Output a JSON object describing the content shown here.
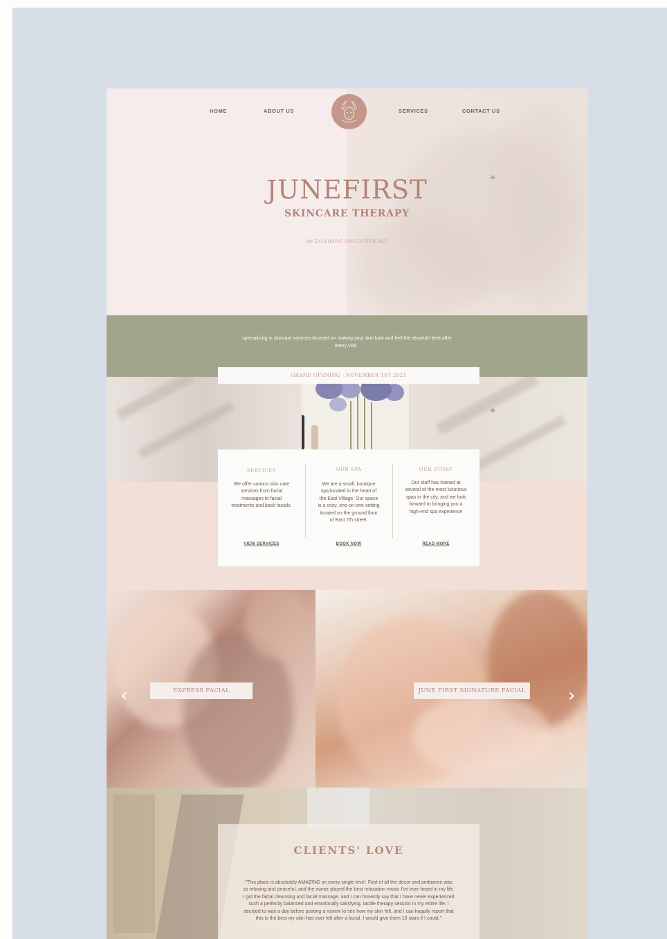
{
  "nav": {
    "home": "HOME",
    "about": "ABOUT US",
    "services": "SERVICES",
    "contact": "CONTACT US"
  },
  "hero": {
    "title": "JUNEFIRST",
    "subtitle": "SKINCARE THERAPY",
    "tagline": "AN EXCLUSIVE SPA EXPERIENCE"
  },
  "band": {
    "text": "specializing in skincare services focused on making your skin look and feel the absolute best after every visit ."
  },
  "announcement": "GRAND OPENING - NOVEMBER 1ST 2021",
  "columns": [
    {
      "title": "SERVICES",
      "body": "We offer various skin care services from facial massages to facial treatments and back facials.",
      "link": "VIEW SERVICES"
    },
    {
      "title": "OUR SPA",
      "body": "We are a small, boutique spa located in the heart of the East Village.  Our space is a cozy, one-on-one setting located on the ground floor of East 7th street.",
      "link": "BOOK NOW"
    },
    {
      "title": "OUR STORY",
      "body": "Our staff has trained at several of the most luxurious spas in the city, and we look forward to bringing you a high-end spa experience",
      "link": "READ MORE"
    }
  ],
  "carousel": {
    "left_label": "EXPRESS FACIAL",
    "right_label": "JUNE FIRST SIGNATURE FACIAL",
    "prev_glyph": "‹",
    "next_glyph": "›"
  },
  "testimonials": {
    "title": "CLIENTS' LOVE",
    "quote": "\"This place is absolutely AMAZING on every single level. First of all the decor and ambiance was so relaxing and peaceful, and the owner played the best relaxation music I've ever heard in my life. I got the facial cleansing and facial massage, and I can honestly say that I have never experienced such a perfectly balanced and emotionally satisfying, tactile therapy session in my entire life. I decided to wait a day before posting a review to see how my skin felt, and I can happily report that this is the best my skin has ever felt after a facial. I would give them 10 stars if I could.\"",
    "next_glyph": "›"
  },
  "icons": {
    "logo": "face-hands-logo-icon",
    "sparkle": "sparkle-icon"
  },
  "colors": {
    "brand_rose": "#b38476",
    "logo_circle": "#c4978b",
    "sage_band": "#a1a58b",
    "blush": "#f1dfd8"
  }
}
